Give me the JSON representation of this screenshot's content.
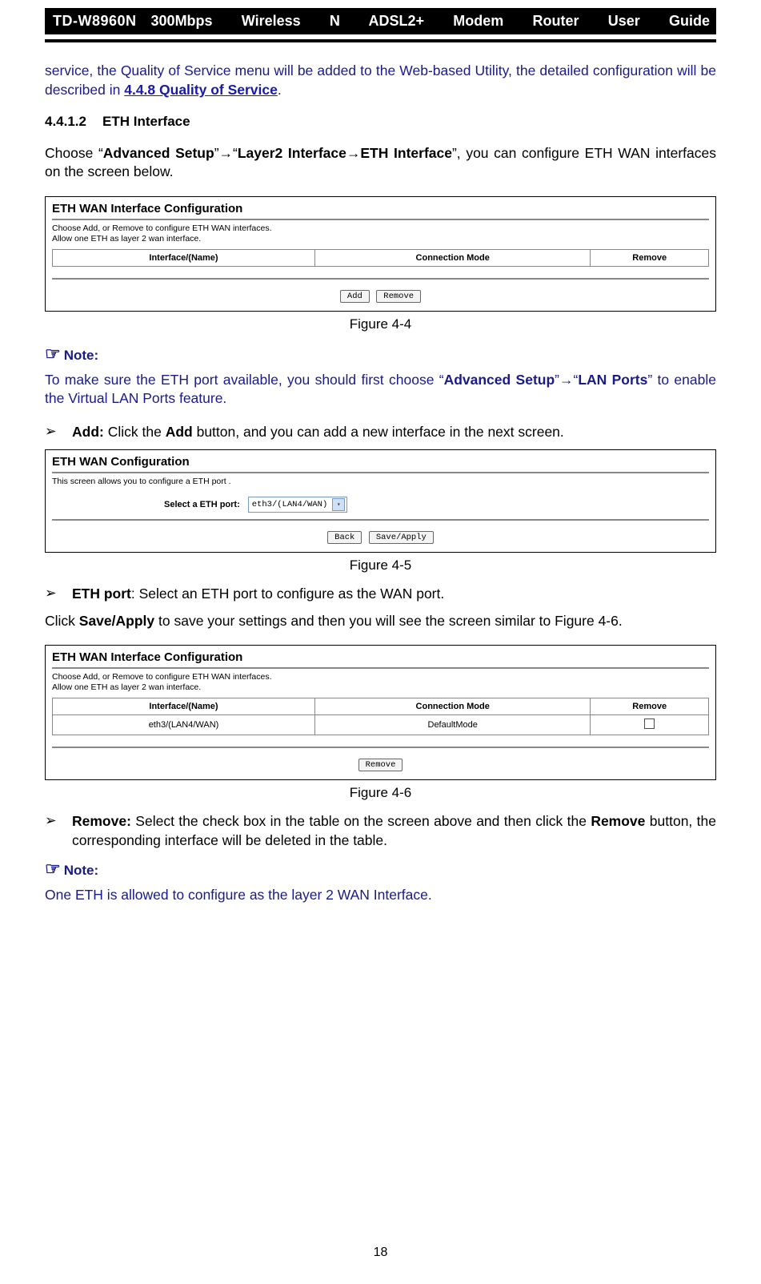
{
  "header": {
    "model": "TD-W8960N",
    "title": "300Mbps Wireless N ADSL2+ Modem Router User Guide"
  },
  "intro": {
    "pretext": "service, the Quality of Service menu will be added to the Web-based Utility, the detailed configuration will be described in ",
    "link": "4.4.8 Quality of Service",
    "after": "."
  },
  "section": {
    "num": "4.4.1.2",
    "title": "ETH Interface"
  },
  "nav": {
    "choose": "Choose “",
    "advanced": "Advanced Setup",
    "arrow": "”→“",
    "layer2": "Layer2 Interface→ETH Interface",
    "after": "”, you can configure ETH WAN interfaces on the screen below."
  },
  "fig44": {
    "title": "ETH WAN Interface Configuration",
    "help1": "Choose Add, or Remove to configure ETH WAN interfaces.",
    "help2": "Allow one ETH as layer 2 wan interface.",
    "cols": {
      "c1": "Interface/(Name)",
      "c2": "Connection Mode",
      "c3": "Remove"
    },
    "btnAdd": "Add",
    "btnRemove": "Remove",
    "caption": "Figure 4-4"
  },
  "note1": {
    "label": "Note:",
    "text_pre": "To make sure the ETH port available, you should first choose “",
    "adv": "Advanced Setup",
    "arrow": "”→“",
    "lan": "LAN Ports",
    "after": "” to enable the Virtual LAN Ports feature."
  },
  "bulletAdd": {
    "label": "Add:",
    "text": " Click the ",
    "bold": "Add",
    "text2": " button, and you can add a new interface in the next screen."
  },
  "fig45": {
    "title": "ETH WAN Configuration",
    "help": "This screen allows you to configure a ETH port .",
    "label": "Select a ETH port:",
    "option": "eth3/(LAN4/WAN)",
    "btnBack": "Back",
    "btnSave": "Save/Apply",
    "caption": "Figure 4-5"
  },
  "bulletEth": {
    "label": "ETH port",
    "text": ": Select an ETH port to configure as the WAN port."
  },
  "saveLine": {
    "pre": "Click ",
    "bold": "Save/Apply",
    "post": " to save your settings and then you will see the screen similar to Figure 4-6."
  },
  "fig46": {
    "title": "ETH WAN Interface Configuration",
    "help1": "Choose Add, or Remove to configure ETH WAN interfaces.",
    "help2": "Allow one ETH as layer 2 wan interface.",
    "cols": {
      "c1": "Interface/(Name)",
      "c2": "Connection Mode",
      "c3": "Remove"
    },
    "row": {
      "c1": "eth3/(LAN4/WAN)",
      "c2": "DefaultMode"
    },
    "btnRemove": "Remove",
    "caption": "Figure 4-6"
  },
  "bulletRemove": {
    "label": "Remove:",
    "text": " Select the check box in the table on the screen above and then click the ",
    "bold": "Remove",
    "text2": " button, the corresponding interface will be deleted in the table."
  },
  "note2": {
    "label": "Note:",
    "text": "One ETH is allowed to configure as the layer 2 WAN Interface."
  },
  "page": "18"
}
